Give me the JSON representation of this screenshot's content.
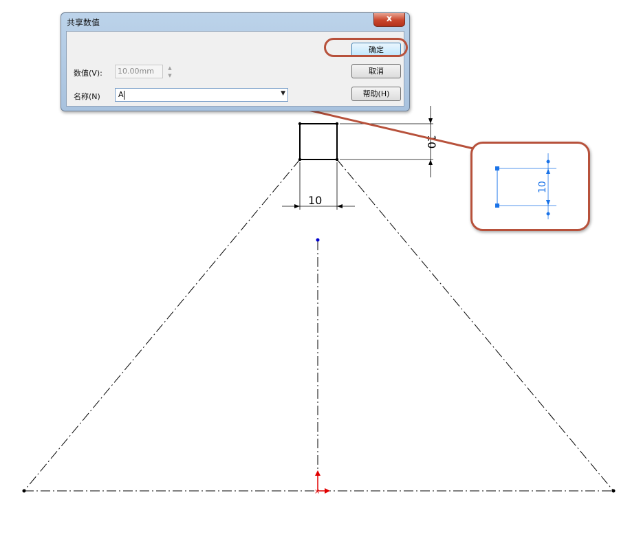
{
  "dialog": {
    "title": "共享数值",
    "close_label": "x",
    "value_label": "数值(V):",
    "value": "10.00mm",
    "name_label": "名称(N)",
    "name_value": "A",
    "buttons": {
      "ok": "确定",
      "cancel": "取消",
      "help": "帮助(H)"
    }
  },
  "sketch": {
    "dim_horizontal": "10",
    "dim_vertical": "10",
    "callout_dim": "10",
    "colors": {
      "line": "#000000",
      "dim_blue": "#1a73e8",
      "highlight": "#b7513b",
      "origin": "#e00000"
    }
  }
}
